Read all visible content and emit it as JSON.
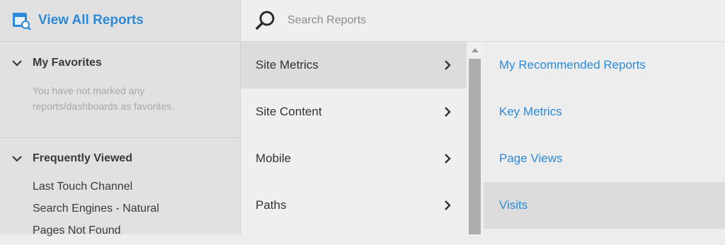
{
  "header": {
    "title": "View All Reports"
  },
  "favorites": {
    "heading": "My Favorites",
    "empty_line1": "You have not marked any",
    "empty_line2": "reports/dashboards as favorites."
  },
  "frequent": {
    "heading": "Frequently Viewed",
    "items": [
      "Last Touch Channel",
      "Search Engines - Natural",
      "Pages Not Found"
    ]
  },
  "search": {
    "placeholder": "Search Reports"
  },
  "categories": [
    "Site Metrics",
    "Site Content",
    "Mobile",
    "Paths"
  ],
  "reports": [
    "My Recommended Reports",
    "Key Metrics",
    "Page Views",
    "Visits"
  ],
  "colors": {
    "accent": "#2d8ad7",
    "selected_bg": "#dcdcdc"
  }
}
